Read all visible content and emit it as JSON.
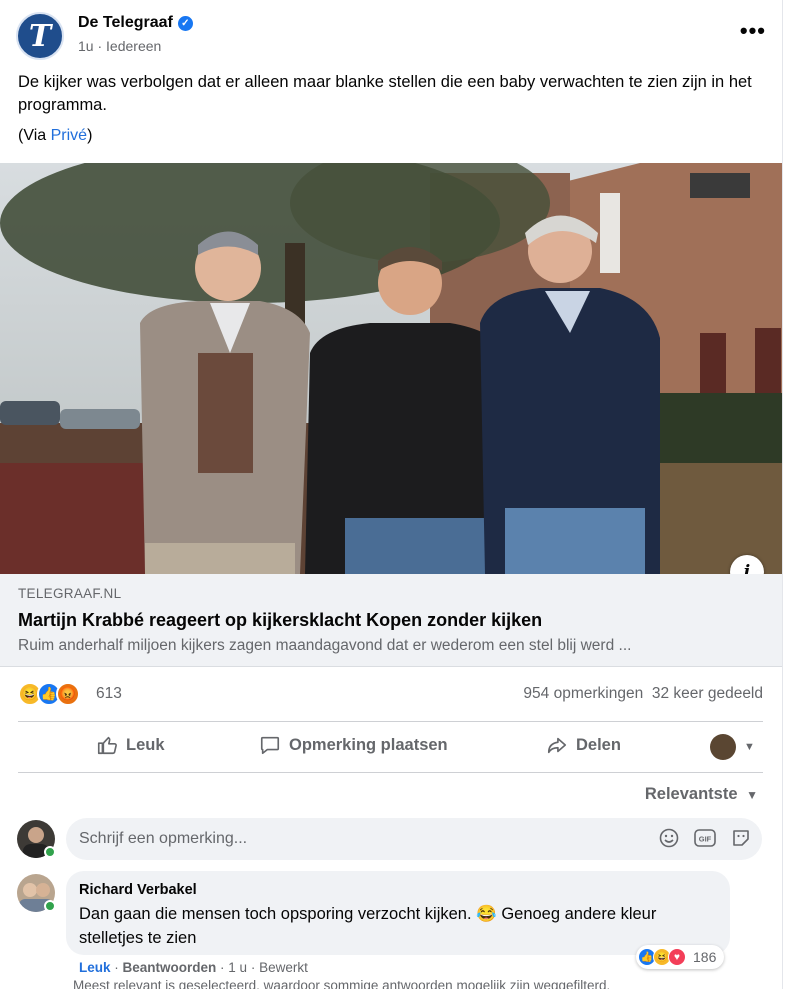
{
  "post": {
    "page_name": "De Telegraaf",
    "logo_letter": "T",
    "time": "1u",
    "separator": "·",
    "audience": "Iedereen",
    "text": "De kijker was verbolgen dat er alleen maar blanke stellen die een baby verwachten te zien zijn in het programma.",
    "via_prefix": "(Via ",
    "via_link": "Privé",
    "via_suffix": ")",
    "more_icon": "more-horizontal-icon"
  },
  "link_preview": {
    "domain": "TELEGRAAF.NL",
    "title": "Martijn Krabbé reageert op kijkersklacht Kopen zonder kijken",
    "description": "Ruim anderhalf miljoen kijkers zagen maandagavond dat er wederom een stel blij werd ...",
    "info_glyph": "i"
  },
  "reactions": {
    "count": "613",
    "comments": "954 opmerkingen",
    "shares": "32 keer gedeeld"
  },
  "actions": {
    "like": "Leuk",
    "comment": "Opmerking plaatsen",
    "share": "Delen"
  },
  "comments": {
    "sort_label": "Relevantste",
    "input_placeholder": "Schrijf een opmerking...",
    "items": [
      {
        "author": "Richard Verbakel",
        "text_part1": "Dan gaan die mensen toch opsporing verzocht kijken.",
        "emoji": "😂",
        "text_part2": "Genoeg andere kleur stelletjes te zien",
        "reaction_count": "186",
        "like_label": "Leuk",
        "reply_label": "Beantwoorden",
        "time": "1 u",
        "edited": "Bewerkt"
      }
    ],
    "filter_note": "Meest relevant is geselecteerd, waardoor sommige antwoorden mogelijk zijn weggefilterd."
  },
  "colors": {
    "link": "#216fdb",
    "secondary_text": "#65676b",
    "like_blue": "#1877f2",
    "online_green": "#31a24c"
  }
}
